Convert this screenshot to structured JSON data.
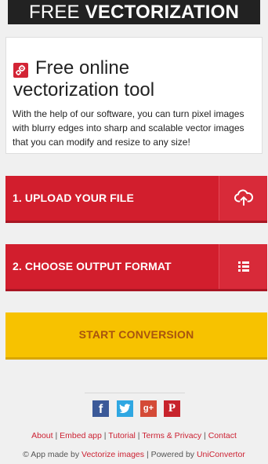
{
  "header": {
    "title_light": "FREE",
    "title_bold": "VECTORIZATION"
  },
  "intro": {
    "logo_icon": "gears-icon",
    "title_line1": "Free online",
    "title_line2": "vectorization tool",
    "description": "With the help of our software, you can turn pixel images with blurry edges into sharp and scalable vector images that you can modify and resize to any size!"
  },
  "steps": {
    "upload_label": "1. UPLOAD YOUR FILE",
    "upload_icon": "cloud-upload-icon",
    "format_label": "2. CHOOSE OUTPUT FORMAT",
    "format_icon": "list-icon",
    "start_label": "START CONVERSION"
  },
  "social": {
    "facebook": "f",
    "twitter_icon": "twitter-bird-icon",
    "googleplus": "g+",
    "pinterest": "P"
  },
  "footer": {
    "links": [
      "About",
      "Embed app",
      "Tutorial",
      "Terms & Privacy",
      "Contact"
    ],
    "separator": "|",
    "credit_prefix": "© App made by",
    "credit_app": "Vectorize images",
    "credit_middle": "| Powered by",
    "credit_powered": "UniConvertor"
  },
  "colors": {
    "header_bg": "#222222",
    "primary_red": "#d21e2d",
    "start_yellow": "#f7c200",
    "start_text": "#a8540f",
    "link_red": "#cc2233"
  }
}
